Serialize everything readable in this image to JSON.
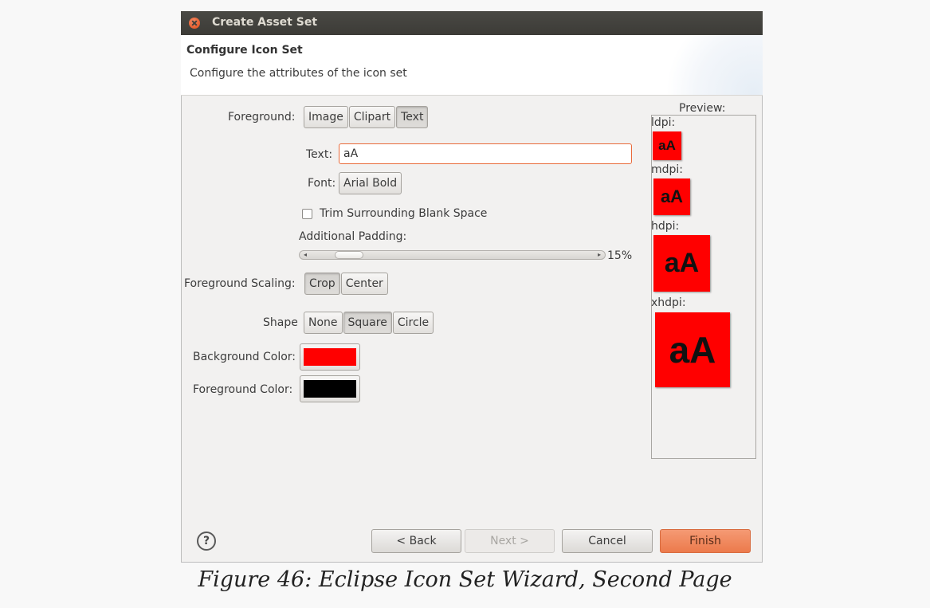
{
  "window": {
    "title": "Create Asset Set"
  },
  "header": {
    "title": "Configure Icon Set",
    "description": "Configure the attributes of the icon set"
  },
  "form": {
    "foreground_label": "Foreground:",
    "foreground_options": [
      "Image",
      "Clipart",
      "Text"
    ],
    "foreground_selected": "Text",
    "text_label": "Text:",
    "text_value": "aA",
    "font_label": "Font:",
    "font_value": "Arial Bold",
    "trim_label": "Trim Surrounding Blank Space",
    "trim_checked": false,
    "padding_label": "Additional Padding:",
    "padding_value_text": "15%",
    "padding_value": 15,
    "scaling_label": "Foreground Scaling:",
    "scaling_options": [
      "Crop",
      "Center"
    ],
    "scaling_selected": "Crop",
    "shape_label": "Shape",
    "shape_options": [
      "None",
      "Square",
      "Circle"
    ],
    "shape_selected": "Square",
    "bg_color_label": "Background Color:",
    "bg_color": "#ff0000",
    "fg_color_label": "Foreground Color:",
    "fg_color": "#000000"
  },
  "preview": {
    "label": "Preview:",
    "items": [
      {
        "density": "ldpi:",
        "text": "aA"
      },
      {
        "density": "mdpi:",
        "text": "aA"
      },
      {
        "density": "hdpi:",
        "text": "aA"
      },
      {
        "density": "xhdpi:",
        "text": "aA"
      }
    ]
  },
  "footer": {
    "help_icon": "question-mark-icon",
    "back": "< Back",
    "next": "Next >",
    "cancel": "Cancel",
    "finish": "Finish"
  },
  "caption": "Figure 46: Eclipse Icon Set Wizard, Second Page"
}
